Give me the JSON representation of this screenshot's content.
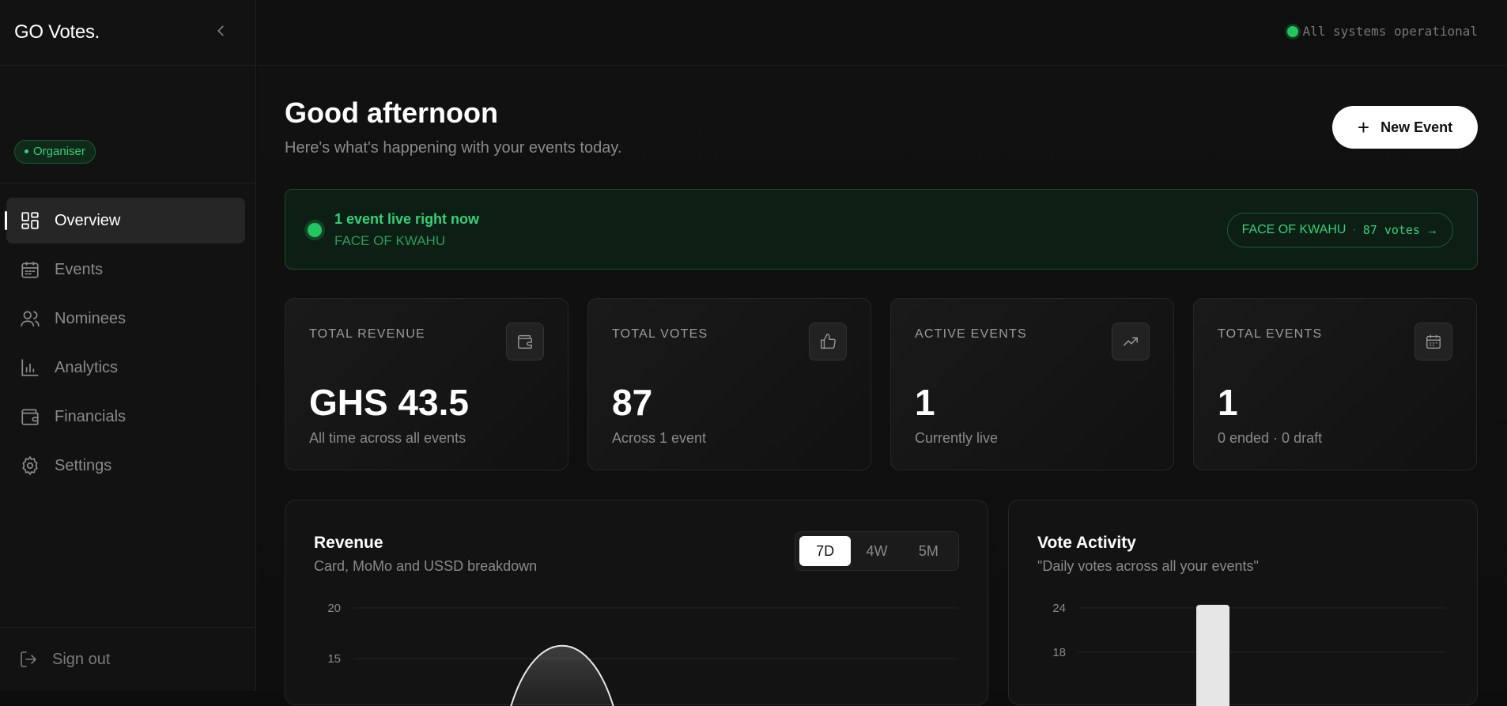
{
  "app": {
    "logo": "GO Votes."
  },
  "sidebar": {
    "role_badge": "Organiser",
    "items": [
      {
        "label": "Overview",
        "icon": "grid-icon",
        "active": true
      },
      {
        "label": "Events",
        "icon": "calendar-icon"
      },
      {
        "label": "Nominees",
        "icon": "users-icon"
      },
      {
        "label": "Analytics",
        "icon": "bar-chart-icon"
      },
      {
        "label": "Financials",
        "icon": "wallet-icon"
      },
      {
        "label": "Settings",
        "icon": "gear-icon"
      }
    ],
    "sign_out": "Sign out"
  },
  "topbar": {
    "status": "All systems operational",
    "status_color": "#22c55e"
  },
  "header": {
    "greeting": "Good afternoon",
    "subtitle": "Here's what's happening with your events today.",
    "new_event": "New Event"
  },
  "live": {
    "title": "1 event live right now",
    "event_name": "FACE OF KWAHU",
    "pill_event": "FACE OF KWAHU",
    "pill_sep": "·",
    "pill_votes": "87 votes",
    "pill_arrow": "→"
  },
  "stats": [
    {
      "label": "TOTAL REVENUE",
      "value": "GHS 43.5",
      "desc": "All time across all events",
      "icon": "wallet-icon"
    },
    {
      "label": "TOTAL VOTES",
      "value": "87",
      "desc": "Across 1 event",
      "icon": "thumbs-up-icon"
    },
    {
      "label": "ACTIVE EVENTS",
      "value": "1",
      "desc": "Currently live",
      "icon": "trending-up-icon"
    },
    {
      "label": "TOTAL EVENTS",
      "value": "1",
      "desc": "0 ended · 0 draft",
      "icon": "calendar-icon"
    }
  ],
  "revenue": {
    "title": "Revenue",
    "subtitle": "Card, MoMo and USSD breakdown",
    "ranges": [
      "7D",
      "4W",
      "5M"
    ],
    "selected_range": "7D"
  },
  "votes_panel": {
    "title": "Vote Activity",
    "subtitle": "\"Daily votes across all your events\""
  },
  "chart_data": [
    {
      "type": "area",
      "title": "Revenue",
      "yticks": [
        20,
        15
      ],
      "ylim": [
        0,
        20
      ],
      "peak": 18,
      "grid": true
    },
    {
      "type": "bar",
      "title": "Vote Activity",
      "yticks": [
        24,
        18
      ],
      "ylim": [
        0,
        24
      ],
      "values": [
        24
      ],
      "grid": true
    }
  ]
}
